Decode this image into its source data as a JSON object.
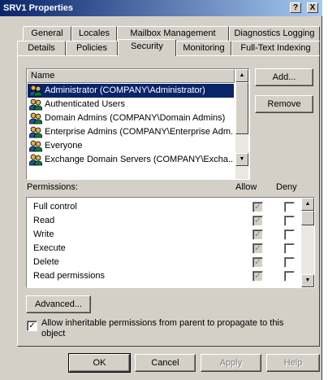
{
  "window": {
    "title": "SRV1 Properties",
    "help_btn": "?",
    "close_btn": "X"
  },
  "tabs_row1": [
    "General",
    "Locales",
    "Mailbox Management",
    "Diagnostics Logging"
  ],
  "tabs_row2": [
    "Details",
    "Policies",
    "Security",
    "Monitoring",
    "Full-Text Indexing"
  ],
  "active_tab": "Security",
  "users_list": {
    "header": "Name",
    "items": [
      {
        "name": "Administrator (COMPANY\\Administrator)",
        "selected": true
      },
      {
        "name": "Authenticated Users",
        "selected": false
      },
      {
        "name": "Domain Admins (COMPANY\\Domain Admins)",
        "selected": false
      },
      {
        "name": "Enterprise Admins (COMPANY\\Enterprise Adm...",
        "selected": false
      },
      {
        "name": "Everyone",
        "selected": false
      },
      {
        "name": "Exchange Domain Servers (COMPANY\\Excha...",
        "selected": false
      }
    ]
  },
  "buttons": {
    "add": "Add...",
    "remove": "Remove",
    "advanced": "Advanced...",
    "ok": "OK",
    "cancel": "Cancel",
    "apply": "Apply",
    "help": "Help"
  },
  "permissions": {
    "label": "Permissions:",
    "allow_header": "Allow",
    "deny_header": "Deny",
    "items": [
      {
        "name": "Full control",
        "allow": true,
        "deny": false
      },
      {
        "name": "Read",
        "allow": true,
        "deny": false
      },
      {
        "name": "Write",
        "allow": true,
        "deny": false
      },
      {
        "name": "Execute",
        "allow": true,
        "deny": false
      },
      {
        "name": "Delete",
        "allow": true,
        "deny": false
      },
      {
        "name": "Read permissions",
        "allow": true,
        "deny": false
      }
    ]
  },
  "inherit": {
    "checked": true,
    "label_line1": "Allow inheritable permissions from parent to propagate to this",
    "label_line2": "object"
  },
  "icons": {
    "user_group": "users-icon",
    "check": "✓"
  }
}
